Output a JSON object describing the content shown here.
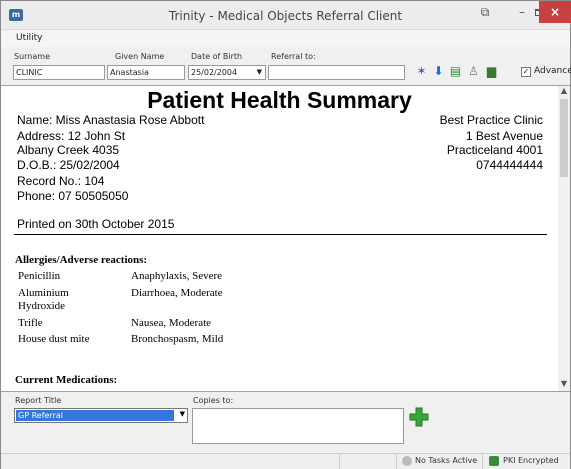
{
  "window": {
    "title": "Trinity - Medical Objects Referral Client"
  },
  "menu": {
    "utility": "Utility"
  },
  "search": {
    "surname_label": "Surname",
    "surname_value": "CLINIC",
    "given_label": "Given Name",
    "given_value": "Anastasia",
    "dob_label": "Date of Birth",
    "dob_value": "25/02/2004",
    "referral_label": "Referral to:",
    "referral_value": "",
    "advanced_label": "Advanced",
    "advanced_checked": true
  },
  "document": {
    "title": "Patient Health Summary",
    "patient": {
      "name": "Name: Miss Anastasia Rose Abbott",
      "address1": "Address: 12 John St",
      "address2": "Albany Creek  4035",
      "dob": "D.O.B.:    25/02/2004",
      "record": "Record No.:  104",
      "phone": "Phone:  07 50505050"
    },
    "clinic": {
      "name": "Best Practice Clinic",
      "address1": "1 Best Avenue",
      "address2": "Practiceland  4001",
      "phone": "0744444444"
    },
    "printed": "Printed on 30th October 2015",
    "allergies_heading": "Allergies/Adverse reactions:",
    "allergies": [
      {
        "item": "Penicillin",
        "reaction": "Anaphylaxis, Severe"
      },
      {
        "item": "Aluminium",
        "item2": "Hydroxide",
        "reaction": "Diarrhoea, Moderate"
      },
      {
        "item": "Trifle",
        "reaction": "Nausea, Moderate"
      },
      {
        "item": "House dust mite",
        "reaction": "Bronchospasm, Mild"
      }
    ],
    "medications_heading": "Current Medications:"
  },
  "bottom": {
    "report_title_label": "Report Title",
    "report_title_value": "GP Referral",
    "copies_label": "Copies to:"
  },
  "status": {
    "tasks": "No Tasks Active",
    "pki": "PKI Encrypted"
  },
  "colors": {
    "close_button": "#c84141",
    "selection": "#3377dd",
    "plus_green": "#3aa53a"
  }
}
